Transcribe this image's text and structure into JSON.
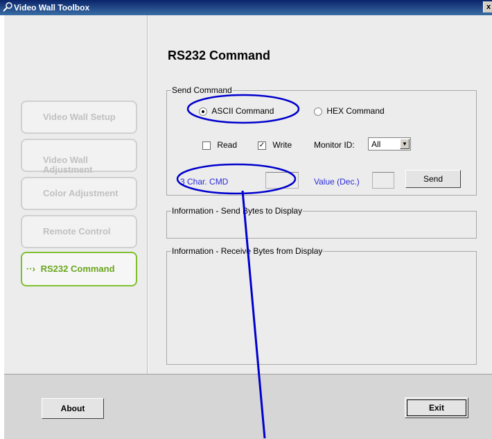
{
  "window": {
    "title": "Video Wall Toolbox",
    "close_label": "x"
  },
  "nav": {
    "items": [
      {
        "label": "Video Wall Setup"
      },
      {
        "label": "Video Wall\nAdjustment"
      },
      {
        "label": "Color Adjustment"
      },
      {
        "label": "Remote Control"
      },
      {
        "label": "RS232 Command",
        "active": true,
        "arrow": "··›"
      }
    ]
  },
  "main": {
    "title": "RS232 Command",
    "send_group": {
      "legend": "Send Command",
      "ascii_label": "ASCII Command",
      "hex_label": "HEX Command",
      "mode_selected": "ASCII Command",
      "read_label": "Read",
      "read_checked": false,
      "write_label": "Write",
      "write_checked": true,
      "monitor_label": "Monitor ID:",
      "monitor_value": "All",
      "cmd_label": "3 Char. CMD",
      "cmd_value": "",
      "value_label": "Value (Dec.)",
      "value_value": "",
      "send_label": "Send"
    },
    "send_bytes_group": {
      "legend": "Information - Send Bytes to Display"
    },
    "receive_bytes_group": {
      "legend": "Information - Receive Bytes from Display"
    }
  },
  "footer": {
    "about_label": "About",
    "exit_label": "Exit"
  },
  "colors": {
    "annotation": "#0000cc",
    "active_nav": "#6aa51d",
    "link_text": "#2a2ad8"
  }
}
